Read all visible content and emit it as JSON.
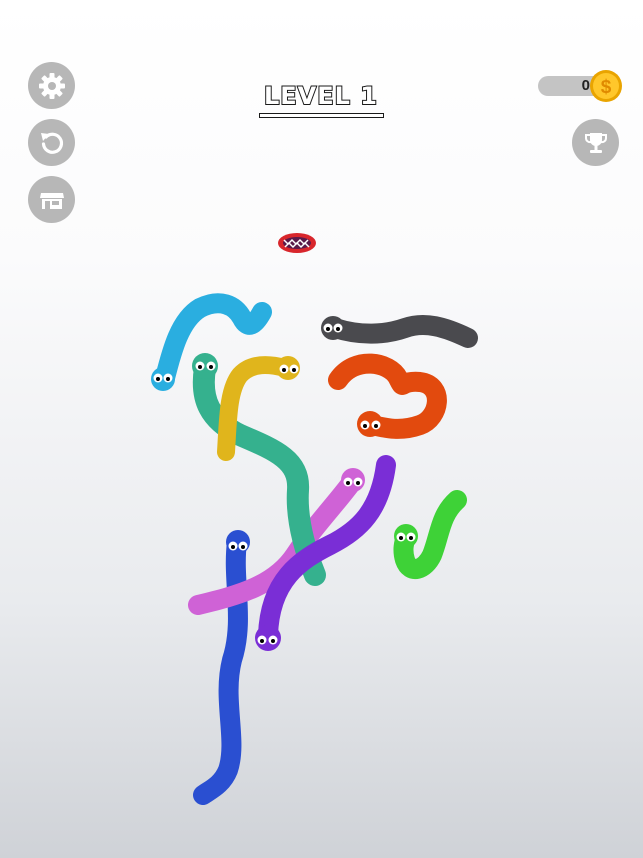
{
  "level": {
    "title": "LEVEL 1"
  },
  "coins": {
    "value": "0",
    "currency_icon": "dollar-coin-icon"
  },
  "side_buttons": {
    "settings_icon": "gear-icon",
    "restart_icon": "restart-icon",
    "shop_icon": "shop-icon",
    "trophy_icon": "trophy-icon"
  },
  "colors": {
    "button_bg": "#b7b7b7",
    "coin_gold": "#f4b400",
    "worm_light_blue": "#2aaee0",
    "worm_gray": "#4a4a4e",
    "worm_orange": "#e24a0e",
    "worm_teal": "#35b18e",
    "worm_yellow": "#e0b51c",
    "worm_pink": "#cf62d6",
    "worm_purple": "#7a2ed6",
    "worm_green": "#3ed237",
    "worm_blue": "#2a4fd1"
  },
  "board": {
    "worm_count": 9,
    "hole_icon": "monster-mouth-icon"
  }
}
